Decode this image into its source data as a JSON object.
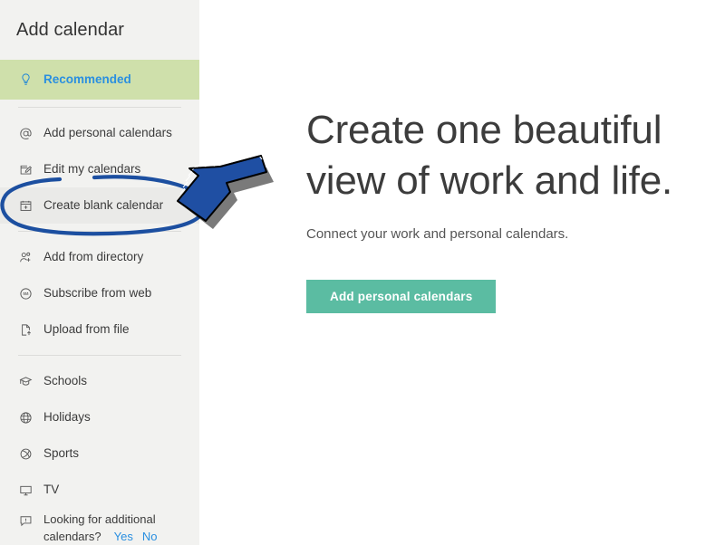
{
  "sidebar": {
    "title": "Add calendar",
    "selected_item": "Recommended",
    "groups": [
      {
        "items": [
          {
            "label": "Recommended",
            "icon": "lightbulb-icon",
            "selected": true
          }
        ]
      },
      {
        "items": [
          {
            "label": "Add personal calendars",
            "icon": "at-sign-icon",
            "selected": false
          },
          {
            "label": "Edit my calendars",
            "icon": "edit-note-icon",
            "selected": false
          },
          {
            "label": "Create blank calendar",
            "icon": "calendar-plus-icon",
            "selected": false
          }
        ]
      },
      {
        "items": [
          {
            "label": "Add from directory",
            "icon": "people-add-icon",
            "selected": false
          },
          {
            "label": "Subscribe from web",
            "icon": "subscribe-circle-icon",
            "selected": false
          },
          {
            "label": "Upload from file",
            "icon": "file-upload-icon",
            "selected": false
          }
        ]
      },
      {
        "items": [
          {
            "label": "Schools",
            "icon": "graduation-cap-icon",
            "selected": false
          },
          {
            "label": "Holidays",
            "icon": "globe-icon",
            "selected": false
          },
          {
            "label": "Sports",
            "icon": "sports-ball-icon",
            "selected": false
          },
          {
            "label": "TV",
            "icon": "monitor-icon",
            "selected": false
          }
        ]
      }
    ],
    "footer": {
      "icon": "feedback-icon",
      "text_line1": "Looking for additional",
      "text_line2": "calendars?",
      "yes_label": "Yes",
      "no_label": "No"
    }
  },
  "main": {
    "title_line1": "Create one beautiful",
    "title_line2": "view of work and life.",
    "subtitle": "Connect your work and personal calendars.",
    "cta_label": "Add personal calendars"
  },
  "annotations": {
    "ellipse": {
      "target": "Create blank calendar",
      "color": "#1c4fa0",
      "shape": "ellipse"
    },
    "arrow": {
      "target": "Create blank calendar",
      "color": "#1c4fa0",
      "shape": "block-arrow",
      "direction": "down-left"
    }
  },
  "colors": {
    "sidebar_bg": "#f2f2f0",
    "selected_row_bg": "#cfe0ab",
    "selected_text": "#2a8fe0",
    "link": "#2a8fe0",
    "cta_bg": "#5bbca2",
    "annotation": "#1c4fa0",
    "heading": "#3c3c3c"
  }
}
